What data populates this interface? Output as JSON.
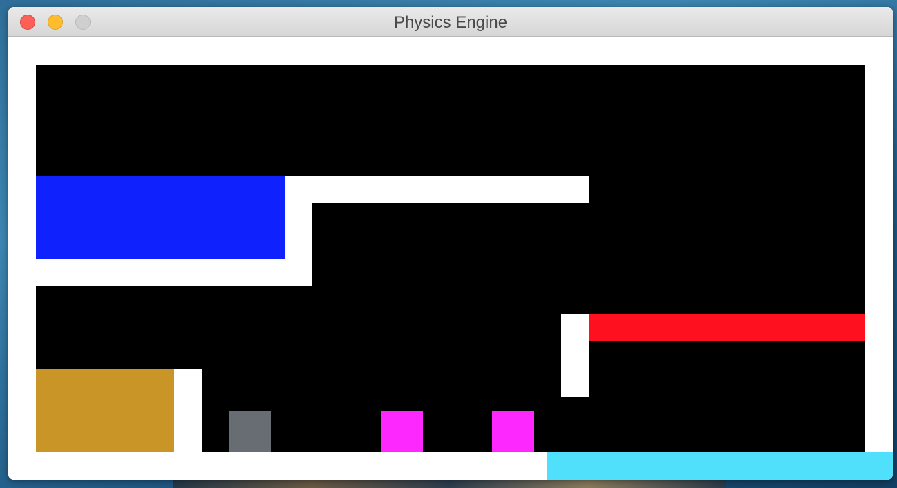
{
  "window": {
    "title": "Physics Engine"
  },
  "colors": {
    "background": "#ffffff",
    "arena": "#000000",
    "wall": "#ffffff",
    "blue_zone": "#0f22fe",
    "red_bar": "#fe101e",
    "gold_block": "#c99526",
    "gray_box": "#686c73",
    "magenta_box": "#fd28fd",
    "cyan_zone": "#51e0fc"
  }
}
